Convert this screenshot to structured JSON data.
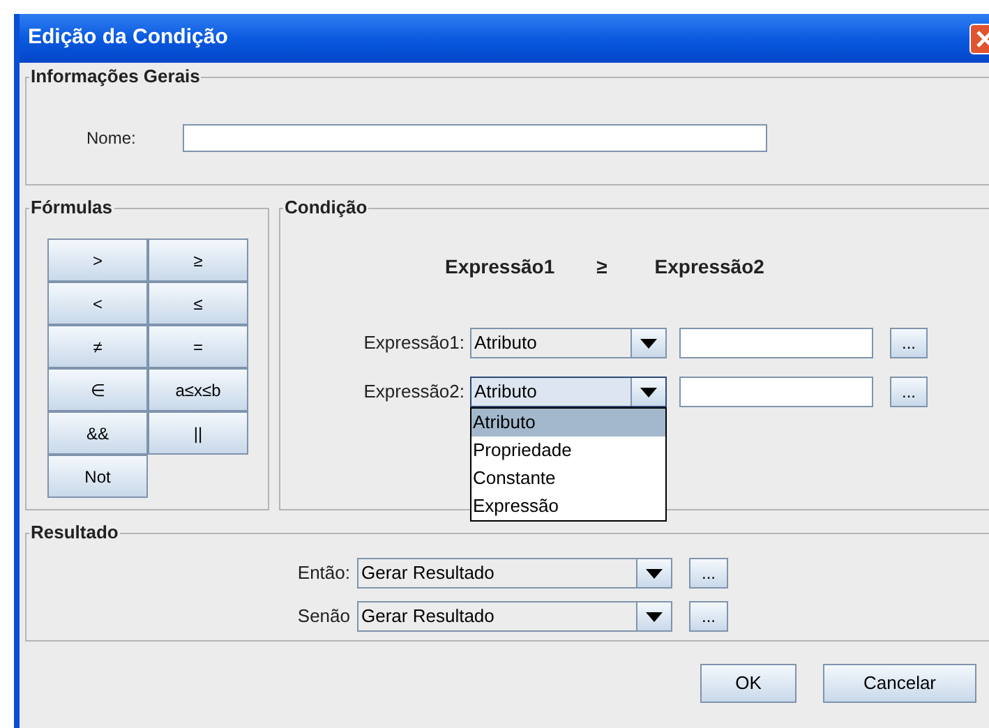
{
  "window": {
    "title": "Edição da Condição"
  },
  "general": {
    "legend": "Informações Gerais",
    "name_label": "Nome:"
  },
  "formulas": {
    "legend": "Fórmulas",
    "buttons": [
      ">",
      "≥",
      "<",
      "≤",
      "≠",
      "=",
      "∈",
      "a≤x≤b",
      "&&",
      "||",
      "Not"
    ]
  },
  "condition": {
    "legend": "Condição",
    "preview": {
      "left": "Expressão1",
      "operator": "≥",
      "right": "Expressão2"
    },
    "rows": [
      {
        "label": "Expressão1:",
        "value": "Atributo",
        "expanded": false
      },
      {
        "label": "Expressão2:",
        "value": "Atributo",
        "expanded": true,
        "options": [
          {
            "label": "Atributo",
            "selected": true
          },
          {
            "label": "Propriedade",
            "selected": false
          },
          {
            "label": "Constante",
            "selected": false
          },
          {
            "label": "Expressão",
            "selected": false
          }
        ]
      }
    ]
  },
  "result": {
    "legend": "Resultado",
    "rows": [
      {
        "label": "Então:",
        "value": "Gerar Resultado"
      },
      {
        "label": "Senão",
        "value": "Gerar Resultado"
      }
    ],
    "more": "..."
  },
  "buttons": [
    "OK",
    "Cancelar"
  ]
}
